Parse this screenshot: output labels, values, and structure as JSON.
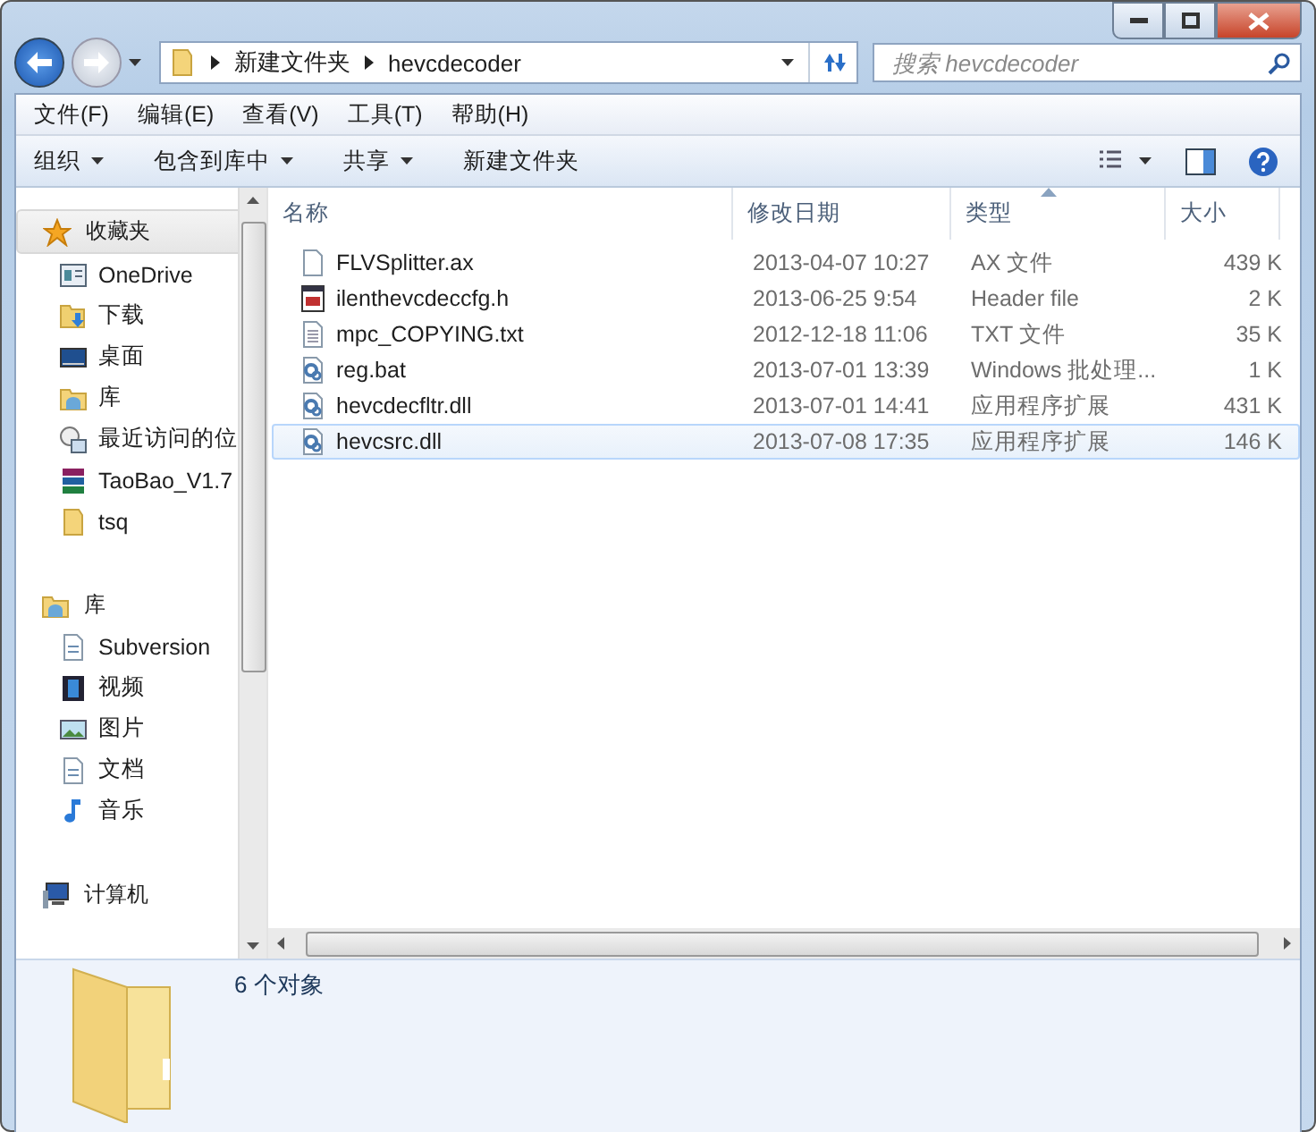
{
  "address": {
    "segments": [
      "新建文件夹",
      "hevcdecoder"
    ]
  },
  "search": {
    "placeholder": "搜索 hevcdecoder"
  },
  "menu": [
    "文件(F)",
    "编辑(E)",
    "查看(V)",
    "工具(T)",
    "帮助(H)"
  ],
  "toolbar": [
    {
      "label": "组织",
      "dropdown": true
    },
    {
      "label": "包含到库中",
      "dropdown": true
    },
    {
      "label": "共享",
      "dropdown": true
    },
    {
      "label": "新建文件夹",
      "dropdown": false
    }
  ],
  "nav": [
    {
      "label": "收藏夹",
      "kind": "star",
      "selected": true,
      "children": [
        {
          "label": "OneDrive",
          "kind": "window"
        },
        {
          "label": "下载",
          "kind": "download"
        },
        {
          "label": "桌面",
          "kind": "desktop"
        },
        {
          "label": "库",
          "kind": "library"
        },
        {
          "label": "最近访问的位",
          "kind": "recent"
        },
        {
          "label": "TaoBao_V1.7",
          "kind": "archive"
        },
        {
          "label": "tsq",
          "kind": "folder"
        }
      ]
    },
    {
      "label": "库",
      "kind": "library",
      "selected": false,
      "children": [
        {
          "label": "Subversion",
          "kind": "doc"
        },
        {
          "label": "视频",
          "kind": "video"
        },
        {
          "label": "图片",
          "kind": "picture"
        },
        {
          "label": "文档",
          "kind": "doc"
        },
        {
          "label": "音乐",
          "kind": "music"
        }
      ]
    },
    {
      "label": "计算机",
      "kind": "computer",
      "selected": false
    }
  ],
  "columns": [
    {
      "label": "名称",
      "sorted": false
    },
    {
      "label": "修改日期",
      "sorted": false
    },
    {
      "label": "类型",
      "sorted": true
    },
    {
      "label": "大小",
      "sorted": false
    }
  ],
  "files": [
    {
      "name": "FLVSplitter.ax",
      "date": "2013-04-07 10:27",
      "type": "AX 文件",
      "size": "439 K",
      "kind": "blank",
      "selected": false
    },
    {
      "name": "ilenthevcdeccfg.h",
      "date": "2013-06-25 9:54",
      "type": "Header file",
      "size": "2 K",
      "kind": "code",
      "selected": false
    },
    {
      "name": "mpc_COPYING.txt",
      "date": "2012-12-18 11:06",
      "type": "TXT 文件",
      "size": "35 K",
      "kind": "text",
      "selected": false
    },
    {
      "name": "reg.bat",
      "date": "2013-07-01 13:39",
      "type": "Windows 批处理...",
      "size": "1 K",
      "kind": "gear",
      "selected": false
    },
    {
      "name": "hevcdecfltr.dll",
      "date": "2013-07-01 14:41",
      "type": "应用程序扩展",
      "size": "431 K",
      "kind": "gear",
      "selected": false
    },
    {
      "name": "hevcsrc.dll",
      "date": "2013-07-08 17:35",
      "type": "应用程序扩展",
      "size": "146 K",
      "kind": "gear",
      "selected": true
    }
  ],
  "status": {
    "count": "6 个对象"
  }
}
